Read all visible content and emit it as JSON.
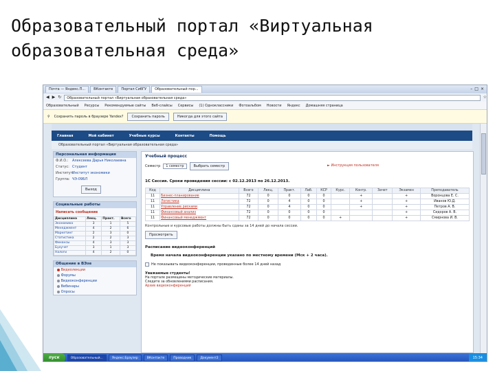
{
  "slide": {
    "title_line1": "Образовательный портал «Виртуальная",
    "title_line2": "образовательная среда»"
  },
  "browser": {
    "tabs": [
      "Почта — Яндекс.П...",
      "ВКонтакте",
      "Портал СибГУ",
      "Образовательный пор..."
    ],
    "active_tab": 3,
    "address": "Образовательный портал «Виртуальная образовательная среда»",
    "bookmarks": [
      "Образовательный",
      "Ресурсы",
      "Рекомендуемые сайты",
      "Веб-слайсы",
      "Сервисы",
      "(1) Одноклассники",
      "Фотоальбом",
      "Новости",
      "Яндекс",
      "Домашняя страница"
    ],
    "password_prompt": "Сохранить пароль в браузере Yandex?",
    "btn_save": "Сохранить пароль",
    "btn_never": "Никогда для этого сайта"
  },
  "site": {
    "nav": [
      "Главная",
      "Мой кабинет",
      "Учебные курсы",
      "Контакты",
      "Помощь"
    ],
    "breadcrumb": "Образовательный портал «Виртуальная образовательная среда»",
    "personal": {
      "header": "Персональная информация",
      "labels": [
        "Ф.И.О.:",
        "Статус:",
        "Институт:",
        "Группа:"
      ],
      "values": [
        "Алексеева Дарья Николаевна",
        "Студент",
        "Институт экономики",
        "ЧЭ-09БЛ"
      ],
      "exit": "Выход"
    },
    "social": {
      "header": "Социальные работы",
      "messages_link": "Написать сообщение",
      "columns": [
        "Дисциплина",
        "Лекц.",
        "Практ.",
        "Всего"
      ],
      "rows": [
        [
          "Экономика",
          "3",
          "1",
          "5"
        ],
        [
          "Менеджмент",
          "4",
          "2",
          "6"
        ],
        [
          "Маркетинг",
          "2",
          "3",
          "0"
        ],
        [
          "Статистика",
          "2",
          "2",
          "3"
        ],
        [
          "Финансы",
          "4",
          "3",
          "3"
        ],
        [
          "Бухучет",
          "3",
          "1",
          "3"
        ],
        [
          "Налоги",
          "4",
          "2",
          "0"
        ]
      ]
    },
    "communication": {
      "header": "Общение в ВЭзе",
      "items": [
        "Видеолекции",
        "Форумы",
        "Видеоконференции",
        "Вебинары",
        "Опросы"
      ]
    },
    "main": {
      "title": "Учебный процесс",
      "semester_label": "Семестр",
      "semester_value": "1 семестр",
      "semester_btn": "Выбрать семестр",
      "instruction_link": "Инструкция пользователя",
      "session_text": "1С Сессия. Сроки проведения сессии: с 02.12.2013 по 26.12.2013.",
      "table_headers": [
        "Код",
        "Дисциплина",
        "Всего",
        "Лекц.",
        "Практ.",
        "Лаб.",
        "КСР",
        "Курс.",
        "Контр.",
        "Зачет",
        "Экзамен",
        "Преподаватель"
      ],
      "table_rows": [
        [
          "11",
          "Бизнес-планирование",
          "72",
          "0",
          "0",
          "0",
          "0",
          "",
          "+",
          "",
          "+",
          "Воронцова Е. С."
        ],
        [
          "11",
          "Логистика",
          "72",
          "0",
          "4",
          "0",
          "0",
          "",
          "+",
          "",
          "+",
          "Иванов Ю.Д."
        ],
        [
          "11",
          "Управление рисками",
          "72",
          "0",
          "4",
          "0",
          "0",
          "",
          "+",
          "",
          "+",
          "Петров А. В."
        ],
        [
          "11",
          "Финансовый анализ",
          "72",
          "0",
          "0",
          "0",
          "0",
          "",
          "",
          "",
          "+",
          "Сидоров А. В."
        ],
        [
          "11",
          "Финансовый менеджмент",
          "72",
          "0",
          "0",
          "0",
          "0",
          "+",
          "",
          "",
          "+",
          "Смирнова И. В."
        ]
      ],
      "note": "Контрольные и курсовые работы должны быть сданы за 14 дней до начала сессии.",
      "plan_btn": "Просмотреть",
      "vc_title": "Расписание видеоконференций",
      "vc_warning": "Время начала видеоконференции указано по местному времени (Мск + 2 часа).",
      "vc_checkbox": "Не показывать видеоконференции, проведенные более 14 дней назад",
      "dear_title": "Уважаемые студенты!",
      "dear_lines": [
        "На портале размещены методические материалы.",
        "Следите за обновлениями расписания.",
        "Архив видеоконференций"
      ]
    }
  },
  "taskbar": {
    "start": "пуск",
    "tasks": [
      "Образовательный...",
      "Яндекс.Браузер",
      "ВКонтакте",
      "Проводник",
      "Документ2"
    ],
    "active_task": 0,
    "tray": "15:34"
  }
}
